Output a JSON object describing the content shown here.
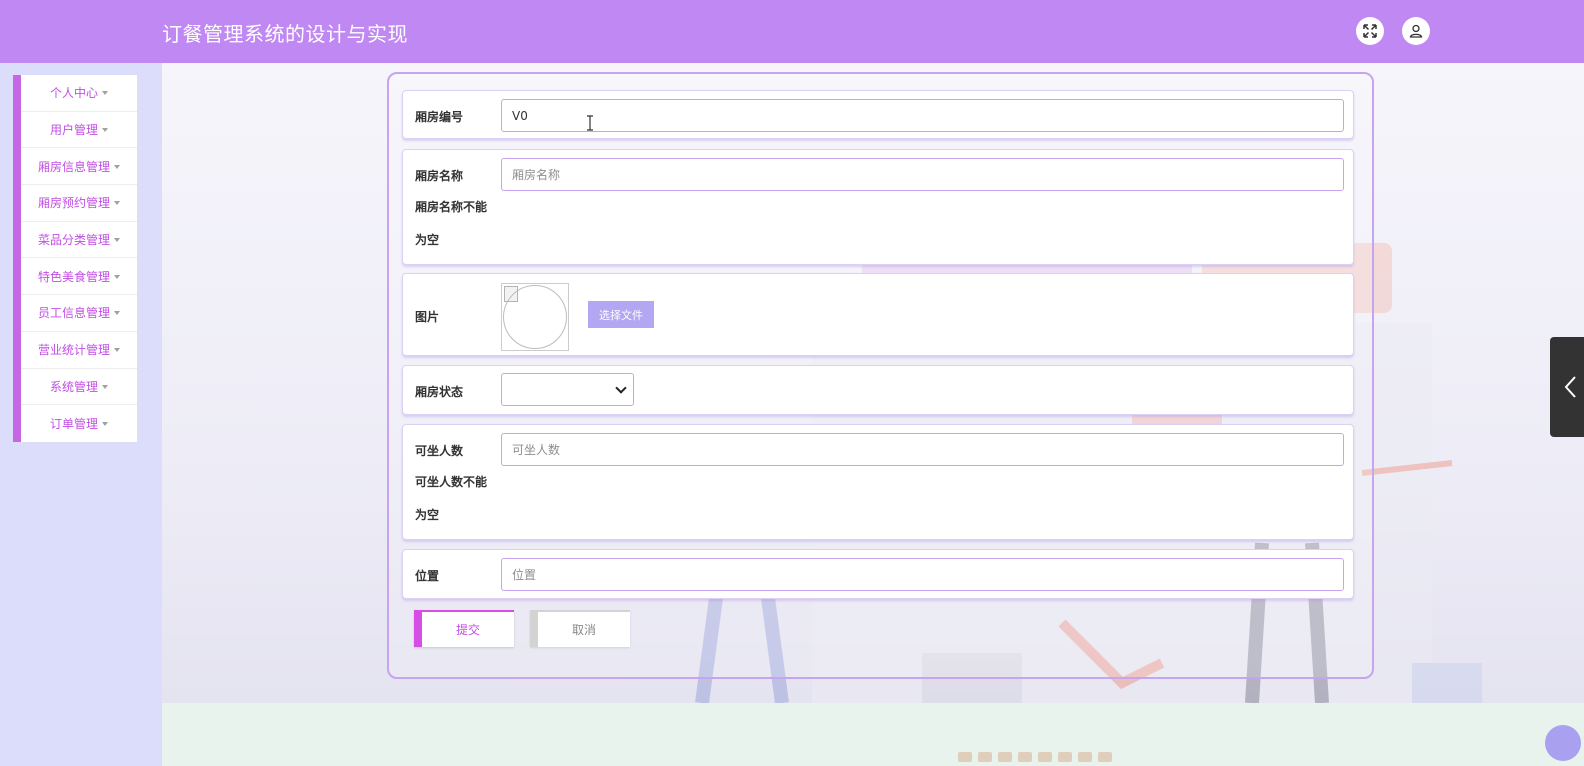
{
  "header": {
    "title": "订餐管理系统的设计与实现",
    "fullscreen_icon": "expand-arrows-icon",
    "user_icon": "user-icon",
    "color": "#c088f3"
  },
  "sidebar": {
    "items": [
      {
        "label": "个人中心"
      },
      {
        "label": "用户管理"
      },
      {
        "label": "厢房信息管理"
      },
      {
        "label": "厢房预约管理"
      },
      {
        "label": "菜品分类管理"
      },
      {
        "label": "特色美食管理"
      },
      {
        "label": "员工信息管理"
      },
      {
        "label": "营业统计管理"
      },
      {
        "label": "系统管理"
      },
      {
        "label": "订单管理"
      }
    ],
    "accent": "#c766e4"
  },
  "form": {
    "room_no": {
      "label": "厢房编号",
      "value": "V0"
    },
    "room_name": {
      "label": "厢房名称",
      "placeholder": "厢房名称",
      "error": [
        "厢房名称不能",
        "为空"
      ]
    },
    "image": {
      "label": "图片",
      "button": "选择文件"
    },
    "status": {
      "label": "厢房状态",
      "value": ""
    },
    "capacity": {
      "label": "可坐人数",
      "placeholder": "可坐人数",
      "error": [
        "可坐人数不能",
        "为空"
      ]
    },
    "location": {
      "label": "位置",
      "placeholder": "位置"
    },
    "submit_label": "提交",
    "cancel_label": "取消"
  },
  "colors": {
    "submit": "#d64ee6",
    "file_button": "#b3a6f2",
    "input_border": "#c7a4ef"
  }
}
